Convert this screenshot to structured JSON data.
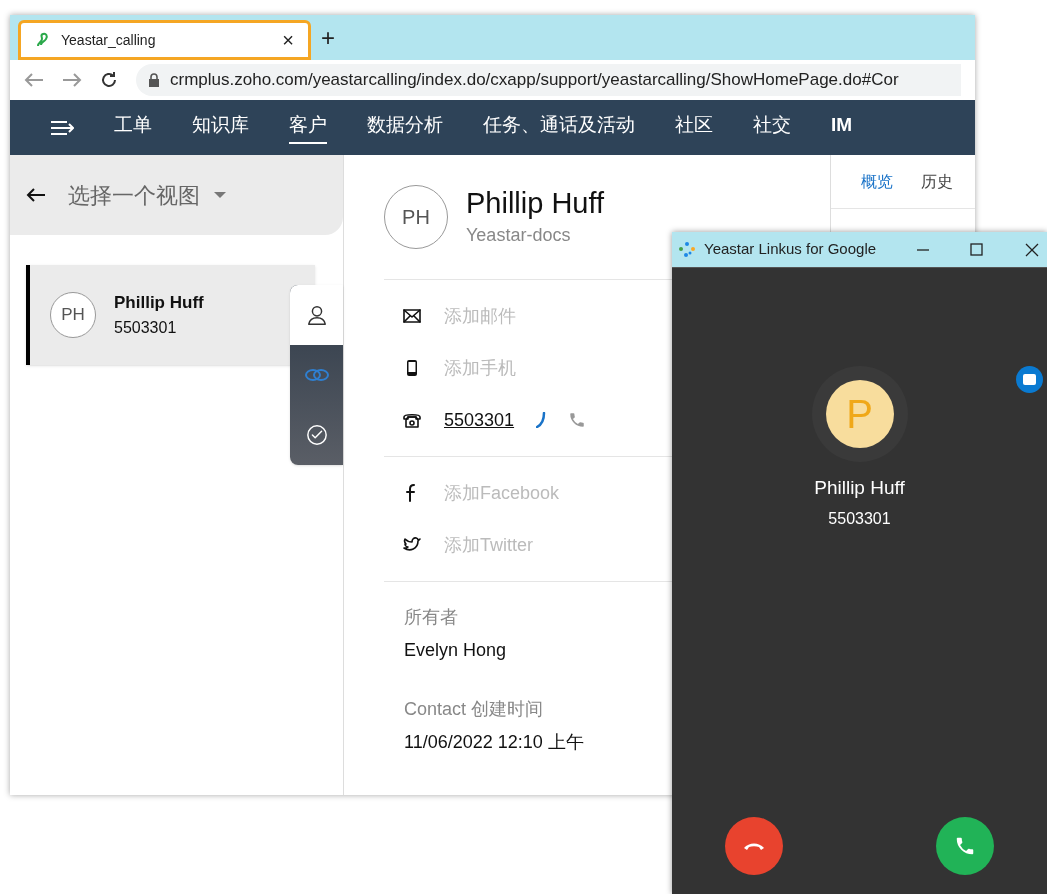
{
  "browser": {
    "tab": {
      "title": "Yeastar_calling",
      "highlighted": true
    },
    "close_tab": "×",
    "new_tab": "+",
    "address": "crmplus.zoho.com/yeastarcalling/index.do/cxapp/support/yeastarcalling/ShowHomePage.do#Cor",
    "nav": [
      {
        "label": "工单",
        "selected": false
      },
      {
        "label": "知识库",
        "selected": false
      },
      {
        "label": "客户",
        "selected": true
      },
      {
        "label": "数据分析",
        "selected": false
      },
      {
        "label": "任务、通话及活动",
        "selected": false
      },
      {
        "label": "社区",
        "selected": false
      },
      {
        "label": "社交",
        "selected": false
      },
      {
        "label": "IM",
        "selected": false
      }
    ],
    "view_selector": "选择一个视图",
    "contacts": [
      {
        "initials": "PH",
        "name": "Phillip Huff",
        "number": "5503301",
        "selected": true
      }
    ],
    "side_tabs": [
      {
        "kind": "person",
        "selected": true
      },
      {
        "kind": "link",
        "selected": false
      },
      {
        "kind": "check",
        "selected": false
      }
    ],
    "detail": {
      "initials": "PH",
      "name": "Phillip Huff",
      "account": "Yeastar-docs",
      "contact_fields": [
        {
          "kind": "email",
          "text": "添加邮件",
          "empty": true
        },
        {
          "kind": "mobile",
          "text": "添加手机",
          "empty": true
        },
        {
          "kind": "phone",
          "text": "5503301",
          "empty": false
        }
      ],
      "social_fields": [
        {
          "kind": "facebook",
          "text": "添加Facebook",
          "empty": true
        },
        {
          "kind": "twitter",
          "text": "添加Twitter",
          "empty": true
        }
      ],
      "owner": {
        "label": "所有者",
        "value": "Evelyn Hong"
      },
      "created": {
        "label": "Contact 创建时间",
        "value": "11/06/2022 12:10 上午"
      }
    },
    "right_tabs": [
      {
        "label": "概览",
        "selected": true
      },
      {
        "label": "历史",
        "selected": false
      }
    ]
  },
  "popup": {
    "title": "Yeastar Linkus for Google",
    "avatar": "P",
    "name": "Phillip Huff",
    "number": "5503301"
  }
}
